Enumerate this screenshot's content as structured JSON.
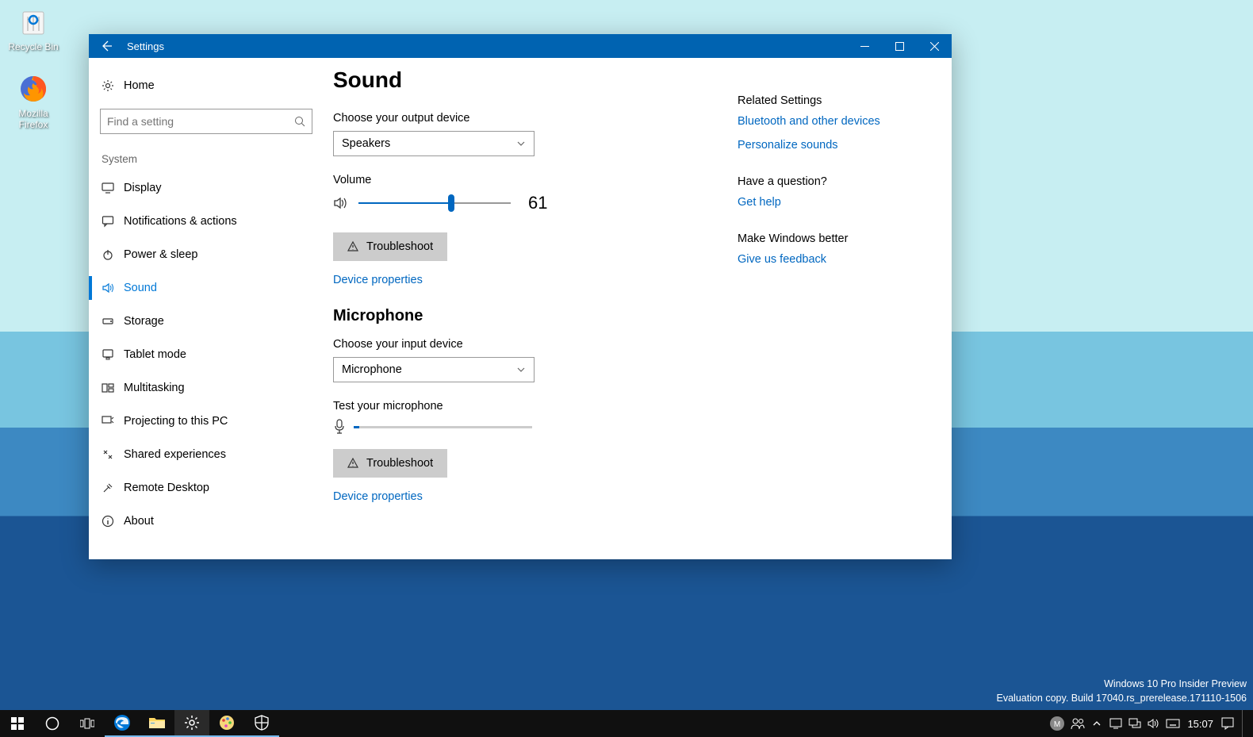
{
  "desktop": {
    "icons": [
      {
        "name": "recycle-bin",
        "label": "Recycle Bin"
      },
      {
        "name": "mozilla-firefox",
        "label": "Mozilla Firefox"
      }
    ],
    "watermark": {
      "line1": "Windows 10 Pro Insider Preview",
      "line2": "Evaluation copy. Build 17040.rs_prerelease.171110-1506"
    }
  },
  "taskbar": {
    "time": "15:07"
  },
  "window": {
    "title": "Settings",
    "sidebar": {
      "home": "Home",
      "search_placeholder": "Find a setting",
      "group": "System",
      "items": [
        {
          "label": "Display"
        },
        {
          "label": "Notifications & actions"
        },
        {
          "label": "Power & sleep"
        },
        {
          "label": "Sound"
        },
        {
          "label": "Storage"
        },
        {
          "label": "Tablet mode"
        },
        {
          "label": "Multitasking"
        },
        {
          "label": "Projecting to this PC"
        },
        {
          "label": "Shared experiences"
        },
        {
          "label": "Remote Desktop"
        },
        {
          "label": "About"
        }
      ]
    },
    "content": {
      "title": "Sound",
      "output_label": "Choose your output device",
      "output_value": "Speakers",
      "volume_label": "Volume",
      "volume_value": "61",
      "volume_percent": 61,
      "troubleshoot": "Troubleshoot",
      "device_props": "Device properties",
      "mic_title": "Microphone",
      "input_label": "Choose your input device",
      "input_value": "Microphone",
      "mic_test_label": "Test your microphone",
      "mic_level_percent": 3
    },
    "aside": {
      "related_heading": "Related Settings",
      "related_links": [
        "Bluetooth and other devices",
        "Personalize sounds"
      ],
      "question_heading": "Have a question?",
      "question_link": "Get help",
      "better_heading": "Make Windows better",
      "better_link": "Give us feedback"
    }
  }
}
